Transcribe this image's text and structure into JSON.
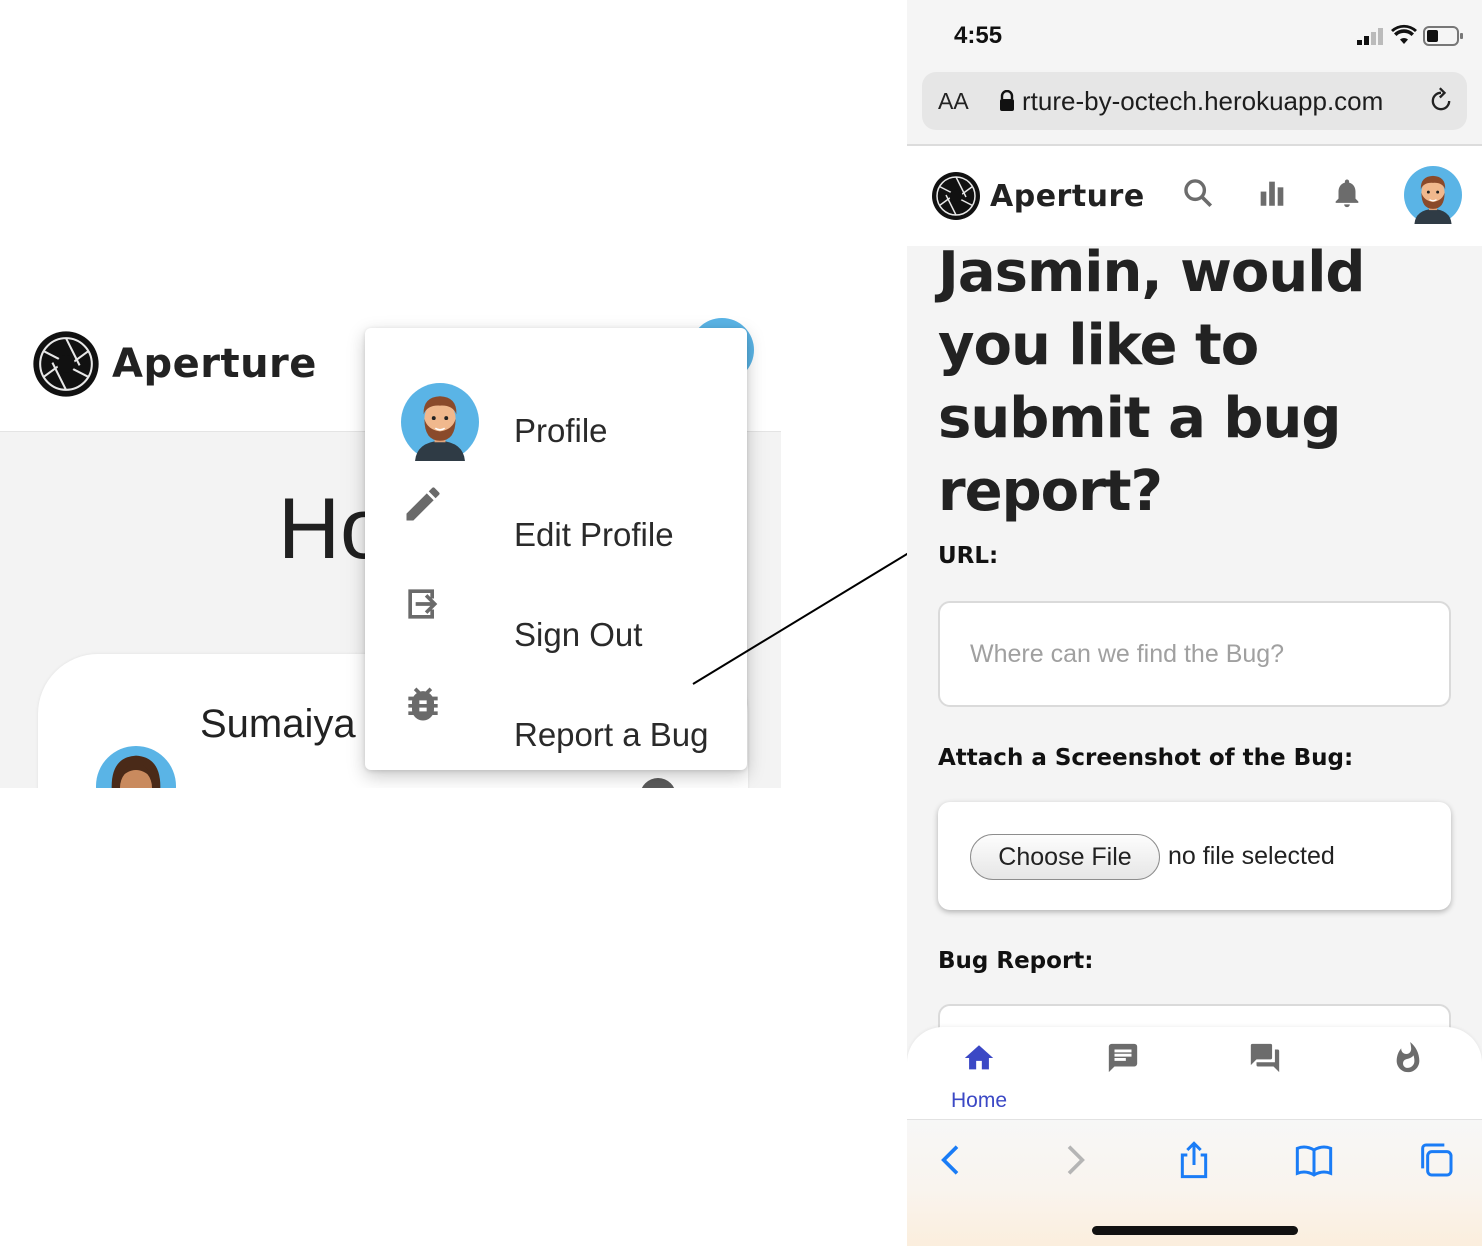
{
  "left_panel": {
    "app_name": "Aperture",
    "page_title_partial": "Ho",
    "card_name": "Sumaiya",
    "menu": {
      "items": [
        {
          "label": "Profile",
          "icon": "avatar"
        },
        {
          "label": "Edit Profile",
          "icon": "pencil-icon"
        },
        {
          "label": "Sign Out",
          "icon": "sign-out-icon"
        },
        {
          "label": "Report a Bug",
          "icon": "bug-icon"
        }
      ]
    }
  },
  "right_panel": {
    "status_bar": {
      "time": "4:55",
      "icons": [
        "signal-icon",
        "wifi-icon",
        "battery-icon"
      ]
    },
    "browser": {
      "text_size_button": "AA",
      "url": "rture-by-octech.herokuapp.com",
      "icons": [
        "lock-icon",
        "reload-icon"
      ]
    },
    "app_bar": {
      "app_name": "Aperture",
      "icons": [
        "search-icon",
        "bar-chart-icon",
        "bell-icon",
        "avatar"
      ]
    },
    "heading": "Jasmin, would you like to submit a bug report?",
    "form": {
      "url_label": "URL:",
      "url_placeholder": "Where can we find the Bug?",
      "screenshot_label": "Attach a Screenshot of the Bug:",
      "choose_file_label": "Choose File",
      "file_status": "no file selected",
      "bug_report_label": "Bug Report:"
    },
    "bottom_nav": {
      "items": [
        {
          "label": "Home",
          "icon": "home-icon",
          "active": true
        },
        {
          "label": "",
          "icon": "message-icon",
          "active": false
        },
        {
          "label": "",
          "icon": "forum-icon",
          "active": false
        },
        {
          "label": "",
          "icon": "fire-icon",
          "active": false
        }
      ]
    },
    "safari_toolbar": {
      "icons": [
        "back-icon",
        "forward-icon",
        "share-icon",
        "bookmarks-icon",
        "tabs-icon"
      ]
    }
  },
  "colors": {
    "accent": "#3b48c5",
    "safari_blue": "#1a7cf6",
    "page_bg": "#f3f3f3"
  }
}
